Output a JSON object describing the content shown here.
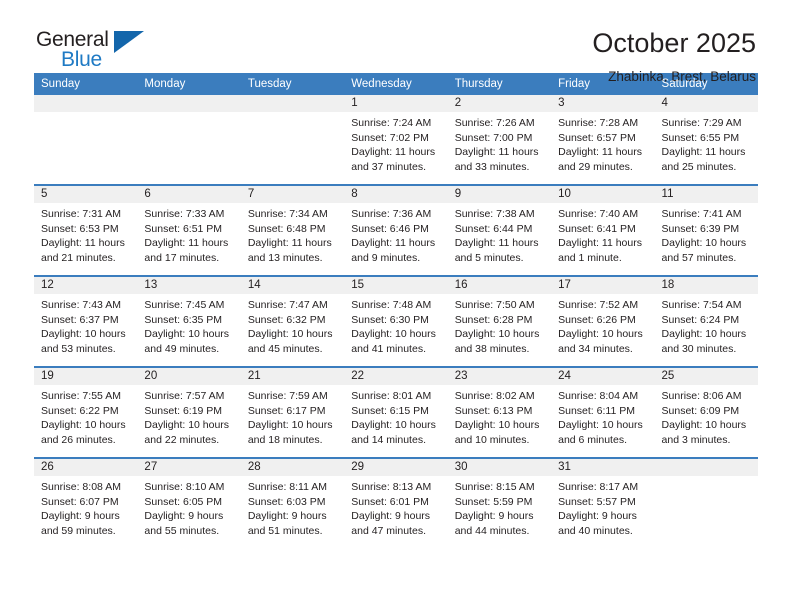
{
  "brand": {
    "name_part1": "General",
    "name_part2": "Blue",
    "triangle_color": "#1366ab",
    "blue_color": "#1f7ac4"
  },
  "header": {
    "title": "October 2025",
    "location": "Zhabinka, Brest, Belarus"
  },
  "theme": {
    "header_row_bg": "#3b7dbe",
    "daynum_strip_bg": "#f0f0f0",
    "text_color": "#231f20"
  },
  "weekday_headers": [
    "Sunday",
    "Monday",
    "Tuesday",
    "Wednesday",
    "Thursday",
    "Friday",
    "Saturday"
  ],
  "weeks": [
    [
      {
        "day": "",
        "empty": true
      },
      {
        "day": "",
        "empty": true
      },
      {
        "day": "",
        "empty": true
      },
      {
        "day": "1",
        "sunrise": "Sunrise: 7:24 AM",
        "sunset": "Sunset: 7:02 PM",
        "daylight_line1": "Daylight: 11 hours",
        "daylight_line2": "and 37 minutes."
      },
      {
        "day": "2",
        "sunrise": "Sunrise: 7:26 AM",
        "sunset": "Sunset: 7:00 PM",
        "daylight_line1": "Daylight: 11 hours",
        "daylight_line2": "and 33 minutes."
      },
      {
        "day": "3",
        "sunrise": "Sunrise: 7:28 AM",
        "sunset": "Sunset: 6:57 PM",
        "daylight_line1": "Daylight: 11 hours",
        "daylight_line2": "and 29 minutes."
      },
      {
        "day": "4",
        "sunrise": "Sunrise: 7:29 AM",
        "sunset": "Sunset: 6:55 PM",
        "daylight_line1": "Daylight: 11 hours",
        "daylight_line2": "and 25 minutes."
      }
    ],
    [
      {
        "day": "5",
        "sunrise": "Sunrise: 7:31 AM",
        "sunset": "Sunset: 6:53 PM",
        "daylight_line1": "Daylight: 11 hours",
        "daylight_line2": "and 21 minutes."
      },
      {
        "day": "6",
        "sunrise": "Sunrise: 7:33 AM",
        "sunset": "Sunset: 6:51 PM",
        "daylight_line1": "Daylight: 11 hours",
        "daylight_line2": "and 17 minutes."
      },
      {
        "day": "7",
        "sunrise": "Sunrise: 7:34 AM",
        "sunset": "Sunset: 6:48 PM",
        "daylight_line1": "Daylight: 11 hours",
        "daylight_line2": "and 13 minutes."
      },
      {
        "day": "8",
        "sunrise": "Sunrise: 7:36 AM",
        "sunset": "Sunset: 6:46 PM",
        "daylight_line1": "Daylight: 11 hours",
        "daylight_line2": "and 9 minutes."
      },
      {
        "day": "9",
        "sunrise": "Sunrise: 7:38 AM",
        "sunset": "Sunset: 6:44 PM",
        "daylight_line1": "Daylight: 11 hours",
        "daylight_line2": "and 5 minutes."
      },
      {
        "day": "10",
        "sunrise": "Sunrise: 7:40 AM",
        "sunset": "Sunset: 6:41 PM",
        "daylight_line1": "Daylight: 11 hours",
        "daylight_line2": "and 1 minute."
      },
      {
        "day": "11",
        "sunrise": "Sunrise: 7:41 AM",
        "sunset": "Sunset: 6:39 PM",
        "daylight_line1": "Daylight: 10 hours",
        "daylight_line2": "and 57 minutes."
      }
    ],
    [
      {
        "day": "12",
        "sunrise": "Sunrise: 7:43 AM",
        "sunset": "Sunset: 6:37 PM",
        "daylight_line1": "Daylight: 10 hours",
        "daylight_line2": "and 53 minutes."
      },
      {
        "day": "13",
        "sunrise": "Sunrise: 7:45 AM",
        "sunset": "Sunset: 6:35 PM",
        "daylight_line1": "Daylight: 10 hours",
        "daylight_line2": "and 49 minutes."
      },
      {
        "day": "14",
        "sunrise": "Sunrise: 7:47 AM",
        "sunset": "Sunset: 6:32 PM",
        "daylight_line1": "Daylight: 10 hours",
        "daylight_line2": "and 45 minutes."
      },
      {
        "day": "15",
        "sunrise": "Sunrise: 7:48 AM",
        "sunset": "Sunset: 6:30 PM",
        "daylight_line1": "Daylight: 10 hours",
        "daylight_line2": "and 41 minutes."
      },
      {
        "day": "16",
        "sunrise": "Sunrise: 7:50 AM",
        "sunset": "Sunset: 6:28 PM",
        "daylight_line1": "Daylight: 10 hours",
        "daylight_line2": "and 38 minutes."
      },
      {
        "day": "17",
        "sunrise": "Sunrise: 7:52 AM",
        "sunset": "Sunset: 6:26 PM",
        "daylight_line1": "Daylight: 10 hours",
        "daylight_line2": "and 34 minutes."
      },
      {
        "day": "18",
        "sunrise": "Sunrise: 7:54 AM",
        "sunset": "Sunset: 6:24 PM",
        "daylight_line1": "Daylight: 10 hours",
        "daylight_line2": "and 30 minutes."
      }
    ],
    [
      {
        "day": "19",
        "sunrise": "Sunrise: 7:55 AM",
        "sunset": "Sunset: 6:22 PM",
        "daylight_line1": "Daylight: 10 hours",
        "daylight_line2": "and 26 minutes."
      },
      {
        "day": "20",
        "sunrise": "Sunrise: 7:57 AM",
        "sunset": "Sunset: 6:19 PM",
        "daylight_line1": "Daylight: 10 hours",
        "daylight_line2": "and 22 minutes."
      },
      {
        "day": "21",
        "sunrise": "Sunrise: 7:59 AM",
        "sunset": "Sunset: 6:17 PM",
        "daylight_line1": "Daylight: 10 hours",
        "daylight_line2": "and 18 minutes."
      },
      {
        "day": "22",
        "sunrise": "Sunrise: 8:01 AM",
        "sunset": "Sunset: 6:15 PM",
        "daylight_line1": "Daylight: 10 hours",
        "daylight_line2": "and 14 minutes."
      },
      {
        "day": "23",
        "sunrise": "Sunrise: 8:02 AM",
        "sunset": "Sunset: 6:13 PM",
        "daylight_line1": "Daylight: 10 hours",
        "daylight_line2": "and 10 minutes."
      },
      {
        "day": "24",
        "sunrise": "Sunrise: 8:04 AM",
        "sunset": "Sunset: 6:11 PM",
        "daylight_line1": "Daylight: 10 hours",
        "daylight_line2": "and 6 minutes."
      },
      {
        "day": "25",
        "sunrise": "Sunrise: 8:06 AM",
        "sunset": "Sunset: 6:09 PM",
        "daylight_line1": "Daylight: 10 hours",
        "daylight_line2": "and 3 minutes."
      }
    ],
    [
      {
        "day": "26",
        "sunrise": "Sunrise: 8:08 AM",
        "sunset": "Sunset: 6:07 PM",
        "daylight_line1": "Daylight: 9 hours",
        "daylight_line2": "and 59 minutes."
      },
      {
        "day": "27",
        "sunrise": "Sunrise: 8:10 AM",
        "sunset": "Sunset: 6:05 PM",
        "daylight_line1": "Daylight: 9 hours",
        "daylight_line2": "and 55 minutes."
      },
      {
        "day": "28",
        "sunrise": "Sunrise: 8:11 AM",
        "sunset": "Sunset: 6:03 PM",
        "daylight_line1": "Daylight: 9 hours",
        "daylight_line2": "and 51 minutes."
      },
      {
        "day": "29",
        "sunrise": "Sunrise: 8:13 AM",
        "sunset": "Sunset: 6:01 PM",
        "daylight_line1": "Daylight: 9 hours",
        "daylight_line2": "and 47 minutes."
      },
      {
        "day": "30",
        "sunrise": "Sunrise: 8:15 AM",
        "sunset": "Sunset: 5:59 PM",
        "daylight_line1": "Daylight: 9 hours",
        "daylight_line2": "and 44 minutes."
      },
      {
        "day": "31",
        "sunrise": "Sunrise: 8:17 AM",
        "sunset": "Sunset: 5:57 PM",
        "daylight_line1": "Daylight: 9 hours",
        "daylight_line2": "and 40 minutes."
      },
      {
        "day": "",
        "empty": true
      }
    ]
  ]
}
